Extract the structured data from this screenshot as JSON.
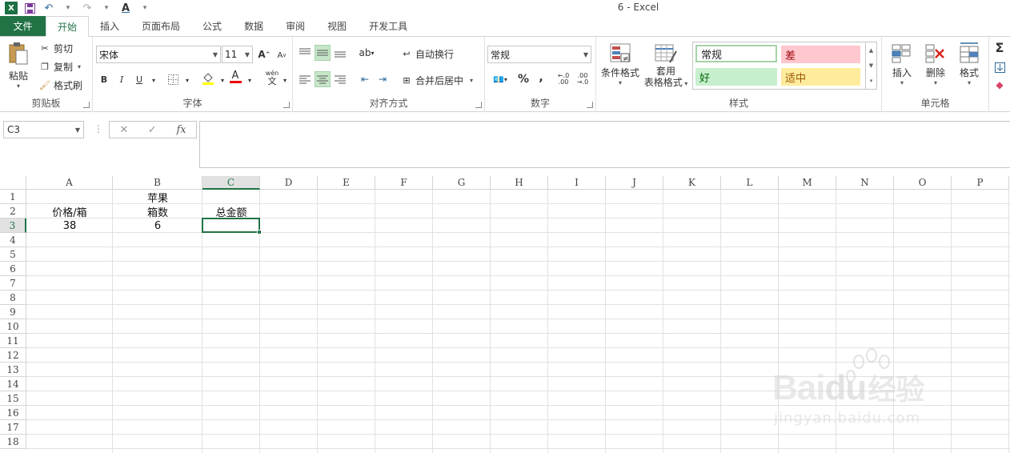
{
  "window": {
    "title": "6 - Excel"
  },
  "tabs": [
    "文件",
    "开始",
    "插入",
    "页面布局",
    "公式",
    "数据",
    "审阅",
    "视图",
    "开发工具"
  ],
  "ribbon": {
    "clipboard": {
      "label": "剪贴板",
      "paste": "粘贴",
      "cut": "剪切",
      "copy": "复制",
      "format_painter": "格式刷"
    },
    "font": {
      "label": "字体",
      "font_name": "宋体",
      "font_size": "11",
      "bold": "B",
      "italic": "I",
      "underline": "U",
      "grow": "A",
      "shrink": "A",
      "color_a": "A",
      "phonetic": "wén"
    },
    "alignment": {
      "label": "对齐方式",
      "wrap_text": "自动换行",
      "merge_center": "合并后居中"
    },
    "number": {
      "label": "数字",
      "format": "常规",
      "percent": "%",
      "comma": ",",
      "inc_decimal": ".00",
      "dec_decimal": ".00"
    },
    "styles": {
      "label": "样式",
      "conditional": "条件格式",
      "table_1": "套用",
      "table_2": "表格格式",
      "normal": "常规",
      "bad": "差",
      "good": "好",
      "neutral": "适中"
    },
    "cells": {
      "label": "单元格",
      "insert": "插入",
      "delete": "删除",
      "format": "格式"
    }
  },
  "formula_bar": {
    "name_box": "C3",
    "fx": "fx",
    "cancel": "✕",
    "enter": "✓",
    "value": ""
  },
  "columns": [
    "A",
    "B",
    "C",
    "D",
    "E",
    "F",
    "G",
    "H",
    "I",
    "J",
    "K",
    "L",
    "M",
    "N",
    "O",
    "P"
  ],
  "rows": [
    "1",
    "2",
    "3",
    "4",
    "5",
    "6",
    "7",
    "8",
    "9",
    "10",
    "11",
    "12",
    "13",
    "14",
    "15",
    "16",
    "17",
    "18"
  ],
  "cells": {
    "B1": "苹果",
    "A2": "价格/箱",
    "B2": "箱数",
    "C2": "总金额",
    "A3": "38",
    "B3": "6",
    "C3": ""
  },
  "selected_cell": "C3",
  "watermark": {
    "brand": "Bai",
    "brand2": "du",
    "cn": "经验",
    "url": "jingyan.baidu.com"
  },
  "colors": {
    "accent": "#217346",
    "bad_bg": "#ffc7ce",
    "bad_fg": "#9c0006",
    "good_bg": "#c6efce",
    "good_fg": "#006100",
    "neutral_bg": "#ffeb9c",
    "neutral_fg": "#9c5700"
  }
}
